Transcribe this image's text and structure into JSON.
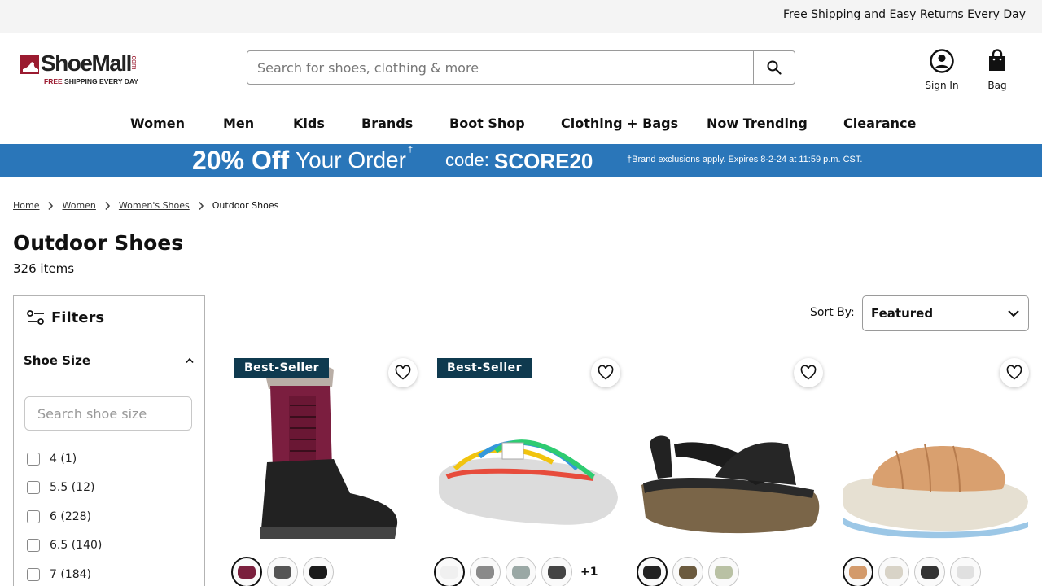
{
  "topbar": {
    "message": "Free Shipping and Easy Returns Every Day"
  },
  "logo": {
    "word": "ShoeMall",
    "com": ".com",
    "tag_red": "FREE",
    "tag_rest": "SHIPPING EVERY DAY"
  },
  "search": {
    "placeholder": "Search for shoes, clothing & more",
    "value": ""
  },
  "account": {
    "signin_label": "Sign In",
    "bag_label": "Bag"
  },
  "nav": [
    "Women",
    "Men",
    "Kids",
    "Brands",
    "Boot Shop",
    "Clothing + Bags",
    "Now Trending",
    "Clearance"
  ],
  "promo": {
    "headline": "20% Off",
    "headline_rest": "Your Order",
    "dagger": "†",
    "code_label": "code:",
    "code": "SCORE20",
    "fine_print": "†Brand exclusions apply. Expires 8-2-24 at 11:59 p.m. CST."
  },
  "breadcrumb": {
    "items": [
      "Home",
      "Women",
      "Women's Shoes"
    ],
    "current": "Outdoor Shoes"
  },
  "page": {
    "title": "Outdoor Shoes",
    "count": "326 items"
  },
  "filters": {
    "title": "Filters",
    "shoe_size": {
      "title": "Shoe Size",
      "search_placeholder": "Search shoe size",
      "options": [
        "4 (1)",
        "5.5 (12)",
        "6 (228)",
        "6.5 (140)",
        "7 (184)"
      ]
    }
  },
  "sort": {
    "label": "Sort By:",
    "value": "Featured"
  },
  "products": [
    {
      "badge": "Best-Seller",
      "swatch_colors": [
        "#7a1f3d",
        "#555555",
        "#1a1a1a"
      ],
      "more": ""
    },
    {
      "badge": "Best-Seller",
      "swatch_colors": [
        "#f0f0f0",
        "#8a8a8a",
        "#9aa8a5",
        "#444444"
      ],
      "more": "+1"
    },
    {
      "badge": "",
      "swatch_colors": [
        "#222222",
        "#6b5a3e",
        "#b9c1a4"
      ],
      "more": ""
    },
    {
      "badge": "",
      "swatch_colors": [
        "#d39a6b",
        "#d8d3c7",
        "#333333",
        "#e0e0e0"
      ],
      "more": ""
    }
  ],
  "colors": {
    "promo_blue": "#2a76b9",
    "brand_red": "#9b1b30",
    "badge_navy": "#0f3a4f"
  }
}
